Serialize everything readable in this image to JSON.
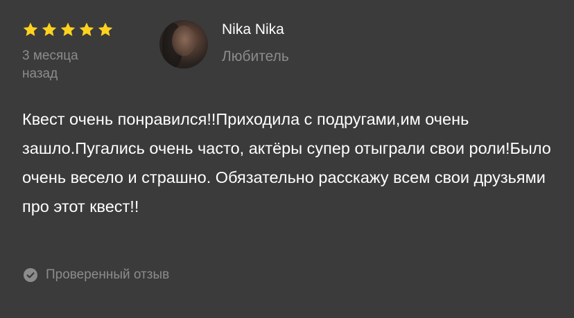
{
  "review": {
    "rating": 5,
    "rating_max": 5,
    "time_ago": "3 месяца назад",
    "author": {
      "name": "Nika Nika",
      "level": "Любитель"
    },
    "text": "Квест очень понравился!!Приходила с подругами,им очень зашло.Пугались очень часто, актёры супер отыграли свои роли!Было очень весело и страшно. Обязательно расскажу всем свои друзьями про этот квест!!",
    "verified_label": "Проверенный отзыв",
    "icons": {
      "star": "star-icon",
      "verified": "check-circle-icon"
    }
  },
  "colors": {
    "background": "#3b3b3b",
    "star": "#ffd21f",
    "primary_text": "#ffffff",
    "secondary_text": "#8c8c8c"
  }
}
